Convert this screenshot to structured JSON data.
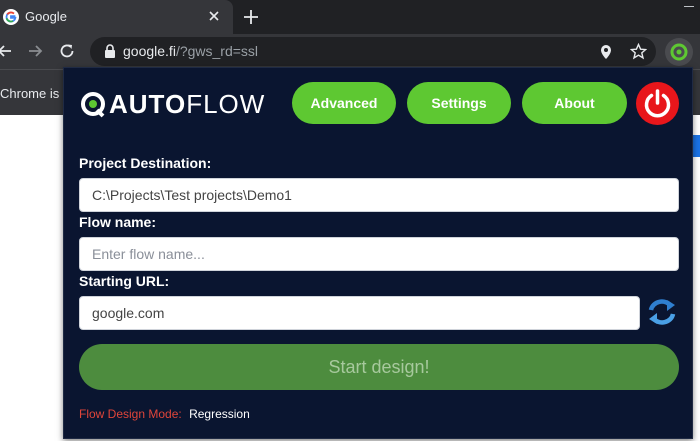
{
  "browser": {
    "tab": {
      "title": "Google",
      "favicon": "google-g-icon"
    },
    "address": {
      "host": "google.fi",
      "path": "/?gws_rd=ssl"
    },
    "infobar_text": "Chrome is b"
  },
  "extension": {
    "logo": {
      "mark": "Q",
      "bold": "AUTO",
      "light": "FLOW"
    },
    "nav": {
      "advanced": "Advanced",
      "settings": "Settings",
      "about": "About"
    },
    "fields": {
      "project_destination_label": "Project Destination:",
      "project_destination_value": "C:\\Projects\\Test projects\\Demo1",
      "flow_name_label": "Flow name:",
      "flow_name_placeholder": "Enter flow name...",
      "starting_url_label": "Starting URL:",
      "starting_url_value": "google.com"
    },
    "start_button": "Start design!",
    "mode": {
      "label": "Flow Design Mode:",
      "value": "Regression"
    },
    "colors": {
      "popup_bg": "#0a1530",
      "accent_green": "#5ec832",
      "start_green": "#4d8c3e",
      "power_red": "#e8161b",
      "mode_label_red": "#e0453a"
    }
  }
}
